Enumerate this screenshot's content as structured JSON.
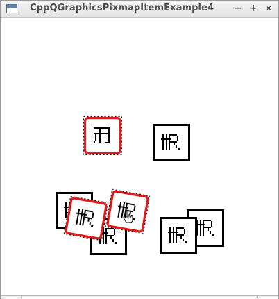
{
  "window": {
    "title": "CppQGraphicsPixmapItemExample4",
    "controls": {
      "minimize": "−",
      "maximize": "+",
      "close": "✕"
    }
  },
  "scene": {
    "item_glyph": "R-pixmap",
    "selected_color": "#e11b1b",
    "item_color": "#000000",
    "items": [
      {
        "name": "pixmap-top-left",
        "selected": true
      },
      {
        "name": "pixmap-top-right",
        "selected": false
      },
      {
        "name": "pixmap-stack-back-left",
        "selected": false
      },
      {
        "name": "pixmap-stack-front-left",
        "selected": true
      },
      {
        "name": "pixmap-stack-bottom-middle",
        "selected": false
      },
      {
        "name": "pixmap-stack-front-middle",
        "selected": true
      },
      {
        "name": "pixmap-right-back",
        "selected": false
      },
      {
        "name": "pixmap-right-front",
        "selected": false
      }
    ]
  }
}
